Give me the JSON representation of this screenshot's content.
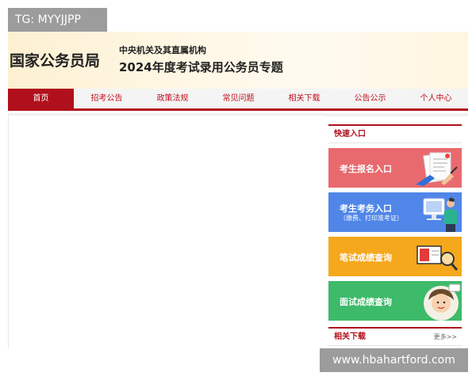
{
  "overlay": {
    "tg_label": "TG: MYYJJPP",
    "watermark": "www.hbahartford.com"
  },
  "header": {
    "site_title": "国家公务员局",
    "subtitle_line1": "中央机关及其直属机构",
    "subtitle_line2": "2024年度考试录用公务员专题"
  },
  "nav": {
    "items": [
      {
        "label": "首页",
        "active": true
      },
      {
        "label": "招考公告"
      },
      {
        "label": "政策法规"
      },
      {
        "label": "常见问题"
      },
      {
        "label": "相关下载"
      },
      {
        "label": "公告公示"
      },
      {
        "label": "个人中心"
      }
    ]
  },
  "sidebar": {
    "quick_title": "快速入口",
    "entries": [
      {
        "label": "考生报名入口",
        "color": "#e86a6e",
        "icon": "document-signing-icon"
      },
      {
        "label": "考生考务入口",
        "sublabel": "（缴费、打印准考证）",
        "color": "#4f86e8",
        "icon": "computer-user-icon"
      },
      {
        "label": "笔试成绩查询",
        "color": "#f6a81c",
        "icon": "magnifier-icon"
      },
      {
        "label": "面试成绩查询",
        "color": "#3dba6a",
        "icon": "interviewee-icon"
      }
    ],
    "downloads_title": "相关下载",
    "more_label": "更多>>"
  },
  "colors": {
    "brand_red": "#b0101c",
    "header_bg": "#fdf0d2"
  }
}
